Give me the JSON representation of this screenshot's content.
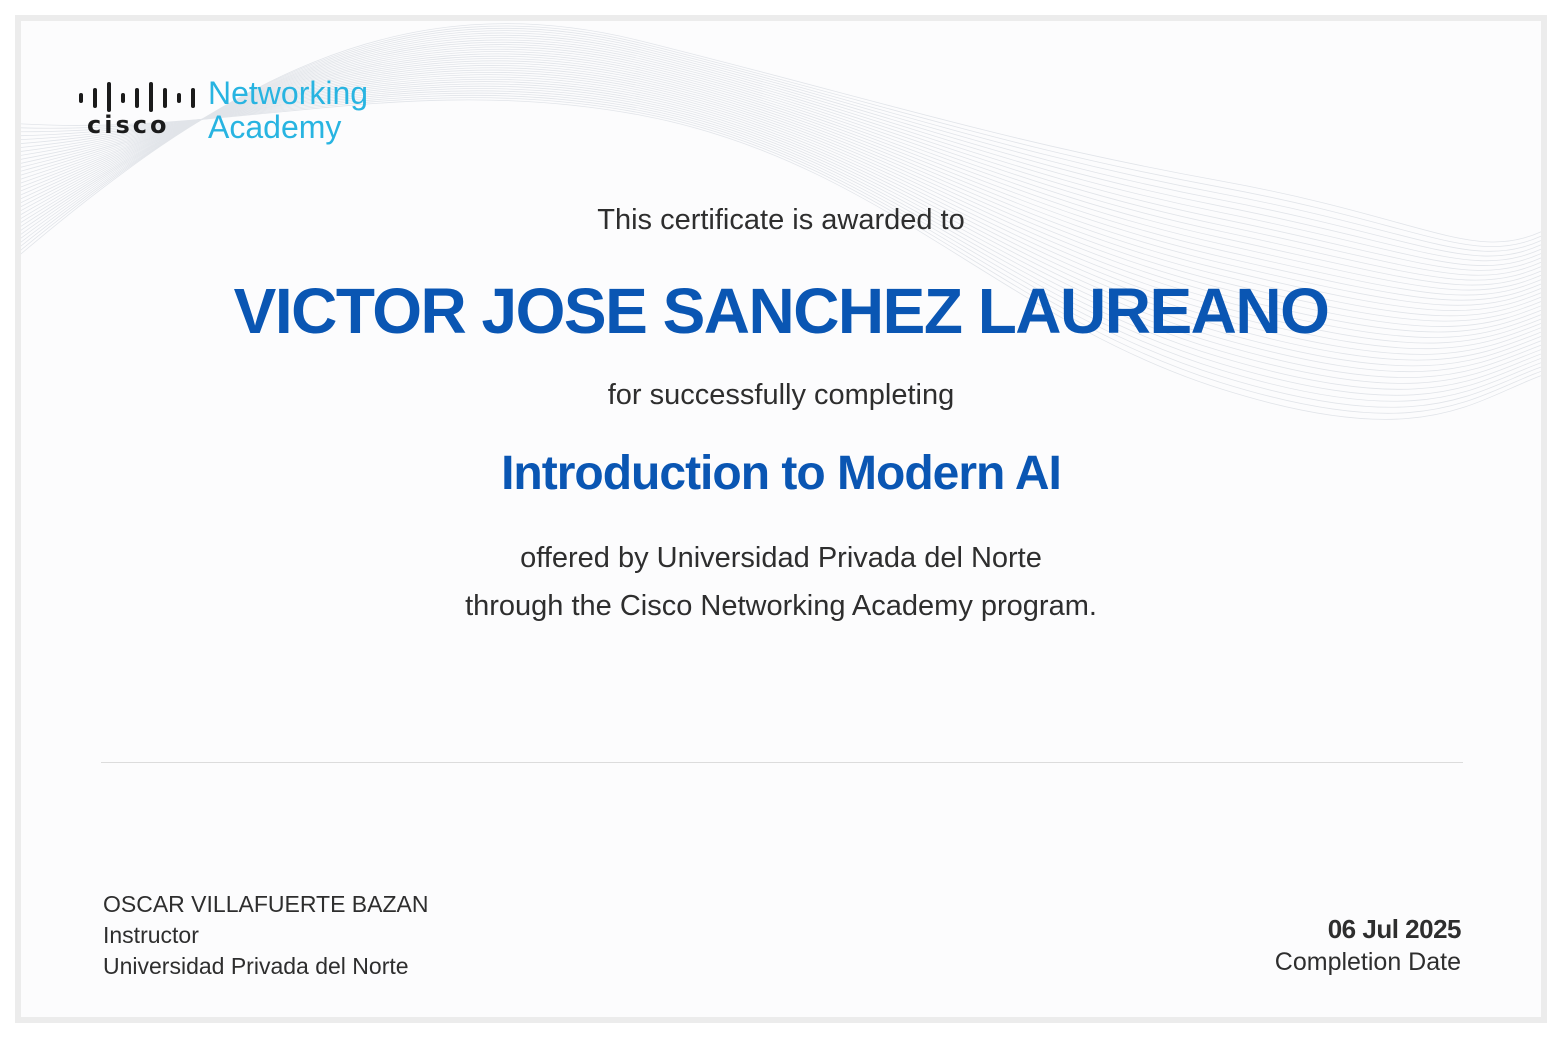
{
  "logo": {
    "wordmark": "cisco",
    "line1": "Networking",
    "line2": "Academy"
  },
  "certificate": {
    "awarded_text": "This certificate is awarded to",
    "recipient": "VICTOR JOSE SANCHEZ LAUREANO",
    "completing_text": "for successfully completing",
    "course": "Introduction to Modern AI",
    "offered_line1": "offered by Universidad Privada del Norte",
    "offered_line2": "through the Cisco Networking Academy program."
  },
  "instructor": {
    "name": "OSCAR VILLAFUERTE BAZAN",
    "role": "Instructor",
    "institution": "Universidad Privada del Norte"
  },
  "completion": {
    "date": "06 Jul 2025",
    "label": "Completion Date"
  },
  "colors": {
    "accent_blue": "#0a56b3",
    "logo_cyan": "#28b4e1",
    "text": "#2e2e2e",
    "frame": "#ececec"
  }
}
